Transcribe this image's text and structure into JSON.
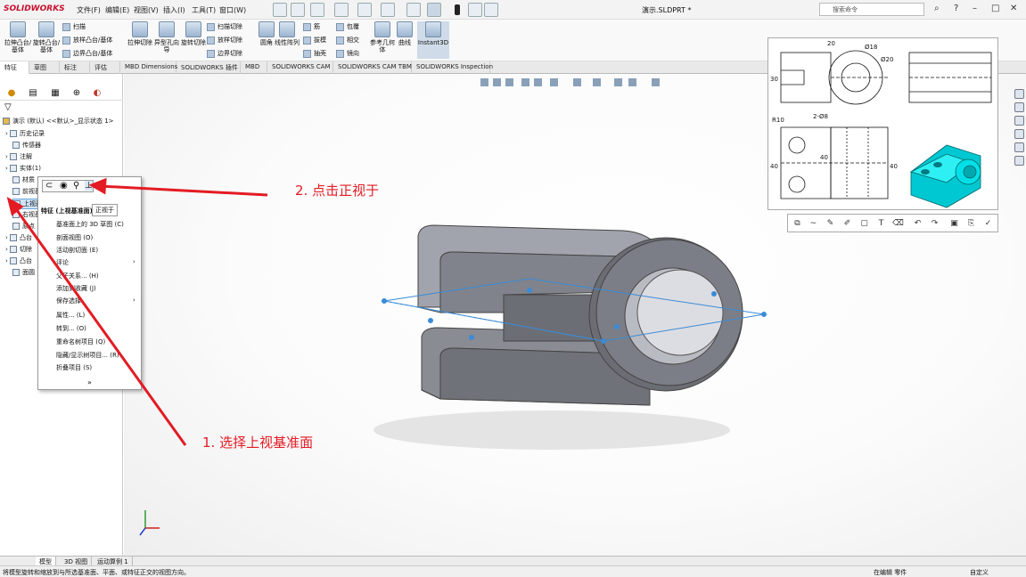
{
  "app": {
    "logo": "SOLIDWORKS",
    "doc_title": "演示.SLDPRT *",
    "search_placeholder": "搜索命令"
  },
  "menus": [
    "文件(F)",
    "编辑(E)",
    "视图(V)",
    "插入(I)",
    "工具(T)",
    "窗口(W)"
  ],
  "ribbon": {
    "big": [
      "拉伸凸台/基体",
      "旋转凸台/基体",
      "拉伸切除",
      "异型孔向导",
      "旋转切除",
      "圆角",
      "线性阵列",
      "参考几何体",
      "曲线",
      "Instant3D"
    ],
    "small": [
      "扫描",
      "放样凸台/基体",
      "边界凸台/基体",
      "扫描切除",
      "放样切除",
      "边界切除",
      "筋",
      "拔模",
      "抽壳",
      "包覆",
      "相交",
      "镜向"
    ]
  },
  "tabs": [
    "特征",
    "草图",
    "标注",
    "评估",
    "MBD Dimensions",
    "SOLIDWORKS 插件",
    "MBD",
    "SOLIDWORKS CAM",
    "SOLIDWORKS CAM TBM",
    "SOLIDWORKS Inspection"
  ],
  "tree": {
    "root": "演示 (默认) <<默认>_显示状态 1>",
    "items": [
      "历史记录",
      "传感器",
      "注解",
      "实体(1)",
      "材质",
      "前视基准面",
      "上视基准面",
      "右视基准面",
      "原点",
      "凸台",
      "切除",
      "凸台",
      "面圆"
    ]
  },
  "context_menu": {
    "title": "特征 (上视基准面)",
    "items": [
      "基准面上的 3D 草图 (C)",
      "剖面视图 (O)",
      "活动剖切面 (E)",
      "评论",
      "父子关系... (H)",
      "添加到收藏 (J)",
      "保存选择",
      "属性... (L)",
      "转到... (O)",
      "重命名树项目 (Q)",
      "隐藏/显示树项目... (R)",
      "折叠项目 (S)"
    ],
    "tooltip": "正视于"
  },
  "annotations": {
    "step1": "1. 选择上视基准面",
    "step2": "2. 点击正视于"
  },
  "drawing": {
    "dim_top": "20",
    "dim_dia18": "Ø18",
    "dim_dia20": "Ø20",
    "dim_left": "30",
    "dim_r10": "R10",
    "dim_holes": "2-Ø8",
    "dim_40a": "40",
    "dim_40b": "40",
    "dim_40c": "40"
  },
  "bottom_tabs": [
    "模型",
    "3D 视图",
    "运动算例 1"
  ],
  "status": {
    "left": "将模型旋转和缩放到与所选基准面、平面、或特征正交的视图方向。",
    "editing": "在编辑 零件",
    "custom": "自定义"
  },
  "colors": {
    "annotation": "#e31b23",
    "part_gray": "#8a8c93",
    "preview_cyan": "#00e0e8",
    "plane_blue": "#3a8bd8"
  }
}
